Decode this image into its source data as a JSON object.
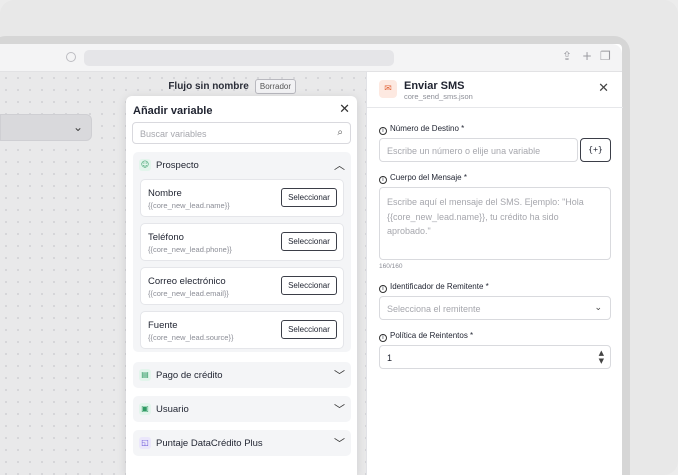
{
  "toolbar": {
    "flow_title": "Flujo sin nombre",
    "draft_badge": "Borrador"
  },
  "variable_panel": {
    "title": "Añadir variable",
    "search_placeholder": "Buscar variables",
    "groups": [
      {
        "label": "Prospecto",
        "expanded": true,
        "items": [
          {
            "name": "Nombre",
            "key": "{{core_new_lead.name}}",
            "action": "Seleccionar"
          },
          {
            "name": "Teléfono",
            "key": "{{core_new_lead.phone}}",
            "action": "Seleccionar"
          },
          {
            "name": "Correo electrónico",
            "key": "{{core_new_lead.email}}",
            "action": "Seleccionar"
          },
          {
            "name": "Fuente",
            "key": "{{core_new_lead.source}}",
            "action": "Seleccionar"
          }
        ]
      },
      {
        "label": "Pago de crédito",
        "expanded": false
      },
      {
        "label": "Usuario",
        "expanded": false
      },
      {
        "label": "Puntaje DataCrédito Plus",
        "expanded": false
      }
    ]
  },
  "sms_panel": {
    "title": "Enviar SMS",
    "subtitle": "core_send_sms.json",
    "fields": {
      "destino": {
        "label": "Número de Destino *",
        "placeholder": "Escribe un número o elije una variable",
        "var_button": "{+}"
      },
      "cuerpo": {
        "label": "Cuerpo del Mensaje *",
        "placeholder": "Escribe aquí el mensaje del SMS. Ejemplo: \"Hola {{core_new_lead.name}}, tu crédito ha sido aprobado.\"",
        "counter": "160/160"
      },
      "remitente": {
        "label": "Identificador de Remitente *",
        "placeholder": "Selecciona el remitente"
      },
      "reintentos": {
        "label": "Política de Reintentos *",
        "value": "1"
      }
    }
  }
}
